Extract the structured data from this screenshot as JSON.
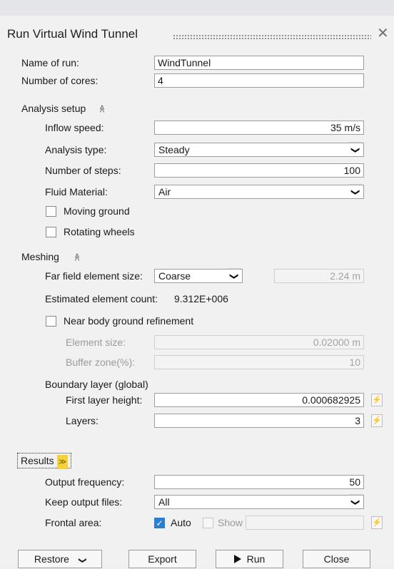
{
  "panel": {
    "title": "Run Virtual Wind Tunnel",
    "close_glyph": "✕"
  },
  "run": {
    "name_label": "Name of run:",
    "name_value": "WindTunnel",
    "cores_label": "Number of cores:",
    "cores_value": "4"
  },
  "analysis": {
    "section_label": "Analysis setup",
    "chevron": "≫",
    "inflow_label": "Inflow speed:",
    "inflow_value": "35 m/s",
    "type_label": "Analysis type:",
    "type_value": "Steady",
    "steps_label": "Number of steps:",
    "steps_value": "100",
    "fluid_label": "Fluid Material:",
    "fluid_value": "Air",
    "moving_ground_label": "Moving ground",
    "rotating_wheels_label": "Rotating wheels"
  },
  "meshing": {
    "section_label": "Meshing",
    "chevron": "≫",
    "far_field_label": "Far field element size:",
    "far_field_value": "Coarse",
    "far_field_size": "2.24 m",
    "estimated_label": "Estimated element count:",
    "estimated_value": "9.312E+006",
    "near_body_label": "Near body ground refinement",
    "element_size_label": "Element size:",
    "element_size_value": "0.02000 m",
    "buffer_label": "Buffer zone(%):",
    "buffer_value": "10",
    "boundary_label": "Boundary layer (global)",
    "first_layer_label": "First layer height:",
    "first_layer_value": "0.000682925",
    "layers_label": "Layers:",
    "layers_value": "3"
  },
  "results": {
    "section_label": "Results",
    "chevron": "≫",
    "output_freq_label": "Output frequency:",
    "output_freq_value": "50",
    "keep_files_label": "Keep output files:",
    "keep_files_value": "All",
    "frontal_label": "Frontal area:",
    "auto_label": "Auto",
    "show_label": "Show"
  },
  "buttons": {
    "restore": "Restore",
    "export": "Export",
    "run": "Run",
    "close": "Close"
  },
  "icons": {
    "dropdown": "❯",
    "checkmark": "✓",
    "lightning": "⚡"
  }
}
